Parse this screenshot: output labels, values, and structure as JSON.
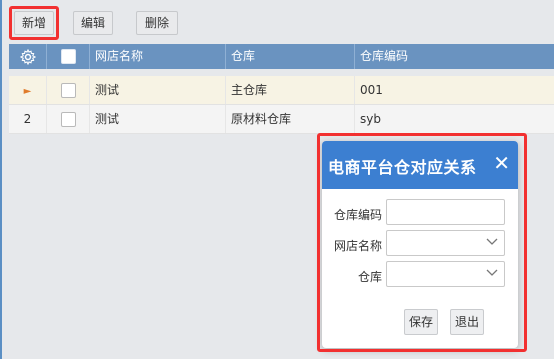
{
  "toolbar": {
    "add_label": "新增",
    "edit_label": "编辑",
    "delete_label": "删除"
  },
  "grid": {
    "columns": [
      "网店名称",
      "仓库",
      "仓库编码"
    ],
    "rows": [
      {
        "index": "",
        "store": "测试",
        "warehouse": "主仓库",
        "code": "001"
      },
      {
        "index": "2",
        "store": "测试",
        "warehouse": "原材料仓库",
        "code": "syb"
      }
    ]
  },
  "modal": {
    "title": "电商平台仓对应关系",
    "fields": {
      "warehouse_code_label": "仓库编码",
      "store_name_label": "网店名称",
      "warehouse_label": "仓库",
      "warehouse_code_value": "",
      "store_name_value": "",
      "warehouse_value": ""
    },
    "save_label": "保存",
    "exit_label": "退出"
  },
  "colors": {
    "header": "#6a93c0",
    "modal_header": "#3c7fd1",
    "highlight": "#f23030"
  }
}
